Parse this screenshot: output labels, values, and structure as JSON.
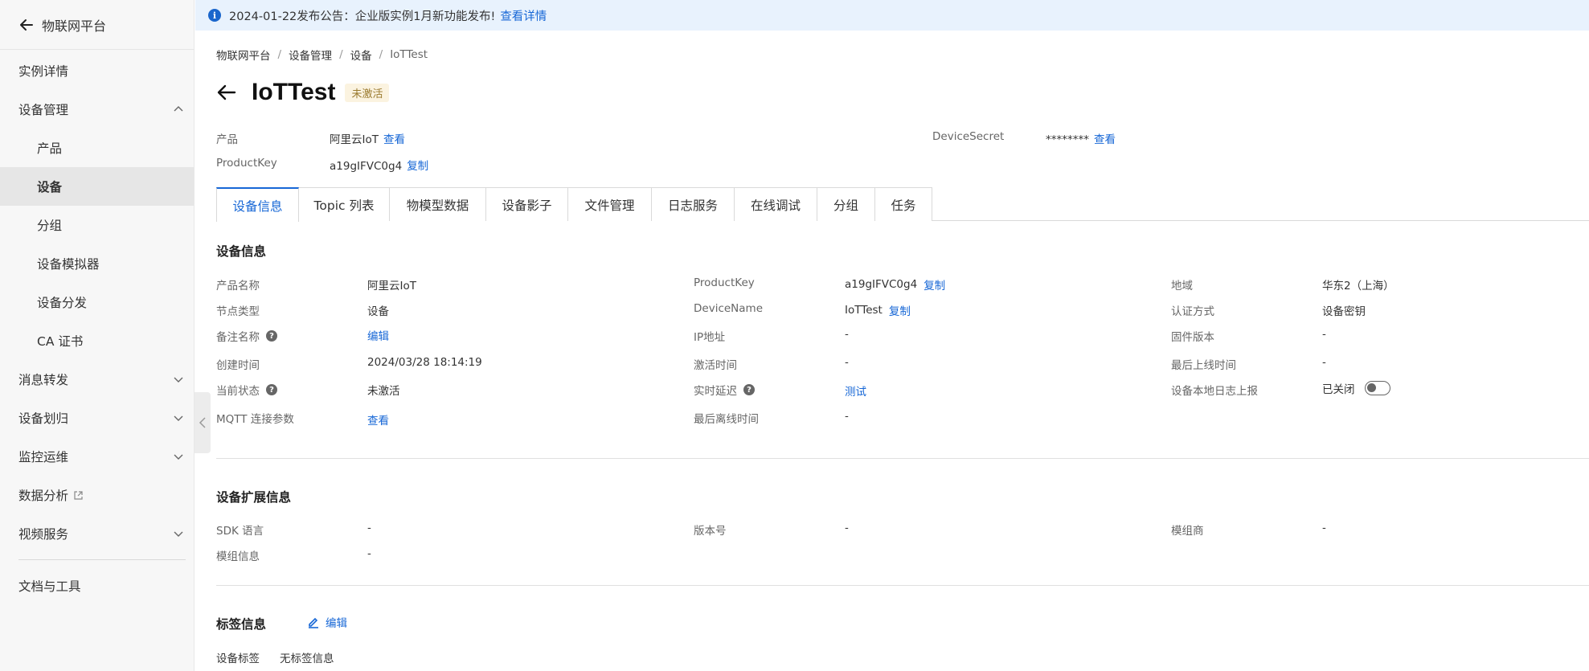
{
  "sidebar": {
    "header": "物联网平台",
    "items": [
      {
        "label": "实例详情"
      },
      {
        "label": "设备管理"
      },
      {
        "label": "产品"
      },
      {
        "label": "设备"
      },
      {
        "label": "分组"
      },
      {
        "label": "设备模拟器"
      },
      {
        "label": "设备分发"
      },
      {
        "label": "CA 证书"
      },
      {
        "label": "消息转发"
      },
      {
        "label": "设备划归"
      },
      {
        "label": "监控运维"
      },
      {
        "label": "数据分析"
      },
      {
        "label": "视频服务"
      },
      {
        "label": "文档与工具"
      }
    ]
  },
  "notice": {
    "text": "2024-01-22发布公告：企业版实例1月新功能发布!",
    "link": "查看详情"
  },
  "breadcrumb": [
    "物联网平台",
    "设备管理",
    "设备",
    "IoTTest"
  ],
  "header": {
    "title": "IoTTest",
    "status": "未激活"
  },
  "summary": {
    "product_label": "产品",
    "product_value": "阿里云IoT",
    "product_link": "查看",
    "productkey_label": "ProductKey",
    "productkey_value": "a19gIFVC0g4",
    "productkey_link": "复制",
    "secret_label": "DeviceSecret",
    "secret_value": "********",
    "secret_link": "查看"
  },
  "tabs": [
    "设备信息",
    "Topic 列表",
    "物模型数据",
    "设备影子",
    "文件管理",
    "日志服务",
    "在线调试",
    "分组",
    "任务"
  ],
  "device_info": {
    "title": "设备信息",
    "col1": [
      {
        "label": "产品名称",
        "value": "阿里云IoT"
      },
      {
        "label": "节点类型",
        "value": "设备"
      },
      {
        "label": "备注名称",
        "value": "编辑"
      },
      {
        "label": "创建时间",
        "value": "2024/03/28 18:14:19"
      },
      {
        "label": "当前状态",
        "value": "未激活"
      },
      {
        "label": "MQTT 连接参数",
        "value": "查看"
      }
    ],
    "col2": [
      {
        "label": "ProductKey",
        "value": "a19gIFVC0g4",
        "link": "复制"
      },
      {
        "label": "DeviceName",
        "value": "IoTTest",
        "link": "复制"
      },
      {
        "label": "IP地址",
        "value": "-"
      },
      {
        "label": "激活时间",
        "value": "-"
      },
      {
        "label": "实时延迟",
        "value": "测试"
      },
      {
        "label": "最后离线时间",
        "value": "-"
      }
    ],
    "col3": [
      {
        "label": "地域",
        "value": "华东2（上海）"
      },
      {
        "label": "认证方式",
        "value": "设备密钥"
      },
      {
        "label": "固件版本",
        "value": "-"
      },
      {
        "label": "最后上线时间",
        "value": "-"
      },
      {
        "label": "设备本地日志上报",
        "value": "已关闭"
      }
    ]
  },
  "ext_info": {
    "title": "设备扩展信息",
    "sdk_label": "SDK 语言",
    "sdk_value": "-",
    "version_label": "版本号",
    "version_value": "-",
    "vendor_label": "模组商",
    "vendor_value": "-",
    "module_label": "模组信息",
    "module_value": "-"
  },
  "tag_info": {
    "title": "标签信息",
    "edit": "编辑",
    "tag_label": "设备标签",
    "tag_value": "无标签信息"
  },
  "colors": {
    "accent": "#1767d6",
    "notice_bg": "#e8f2fd",
    "badge_bg": "#fbf3e0"
  }
}
